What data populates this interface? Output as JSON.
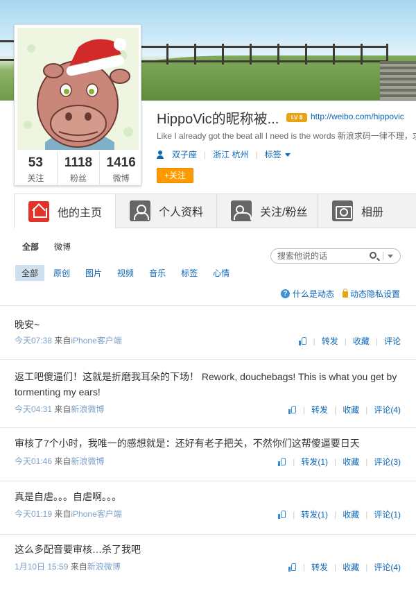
{
  "profile": {
    "nickname": "HippoVic的昵称被...",
    "level_badge": "LV 8",
    "url": "http://weibo.com/hippovic",
    "bio": "Like I already got the beat all I need is the words 新浪求码一律不理，求",
    "zodiac": "双子座",
    "location": "浙江 杭州",
    "tags_label": "标签",
    "follow_button": "+关注",
    "stats": [
      {
        "num": "53",
        "label": "关注"
      },
      {
        "num": "1118",
        "label": "粉丝"
      },
      {
        "num": "1416",
        "label": "微博"
      }
    ]
  },
  "tabs": [
    {
      "label": "他的主页",
      "icon": "home-icon"
    },
    {
      "label": "个人资料",
      "icon": "person-icon"
    },
    {
      "label": "关注/粉丝",
      "icon": "persons-icon"
    },
    {
      "label": "相册",
      "icon": "camera-icon"
    }
  ],
  "filters": {
    "primary": [
      "全部",
      "微博"
    ],
    "secondary": [
      "全部",
      "原创",
      "图片",
      "视频",
      "音乐",
      "标签",
      "心情"
    ],
    "search_placeholder": "搜索他说的话",
    "help_link": "什么是动态",
    "privacy_link": "动态隐私设置"
  },
  "posts": [
    {
      "text": "晚安~",
      "time": "今天07:38",
      "from_label": "来自",
      "source": "iPhone客户端",
      "repost": "转发",
      "fav": "收藏",
      "comment": "评论"
    },
    {
      "text": "返工吧傻逼们！这就是折磨我耳朵的下场！ Rework, douchebags! This is what you get by tormenting my ears!",
      "time": "今天04:31",
      "from_label": "来自",
      "source": "新浪微博",
      "repost": "转发",
      "fav": "收藏",
      "comment": "评论(4)"
    },
    {
      "text": "审核了7个小时，我唯一的感想就是：还好有老子把关，不然你们这帮傻逼要日天",
      "time": "今天01:46",
      "from_label": "来自",
      "source": "新浪微博",
      "repost": "转发(1)",
      "fav": "收藏",
      "comment": "评论(3)"
    },
    {
      "text": "真是自虐。。。自虐啊。。。",
      "time": "今天01:19",
      "from_label": "来自",
      "source": "iPhone客户端",
      "repost": "转发(1)",
      "fav": "收藏",
      "comment": "评论(1)"
    },
    {
      "text": "这么多配音要审核…杀了我吧",
      "time": "1月10日 15:59",
      "from_label": "来自",
      "source": "新浪微博",
      "repost": "转发",
      "fav": "收藏",
      "comment": "评论(4)"
    }
  ]
}
